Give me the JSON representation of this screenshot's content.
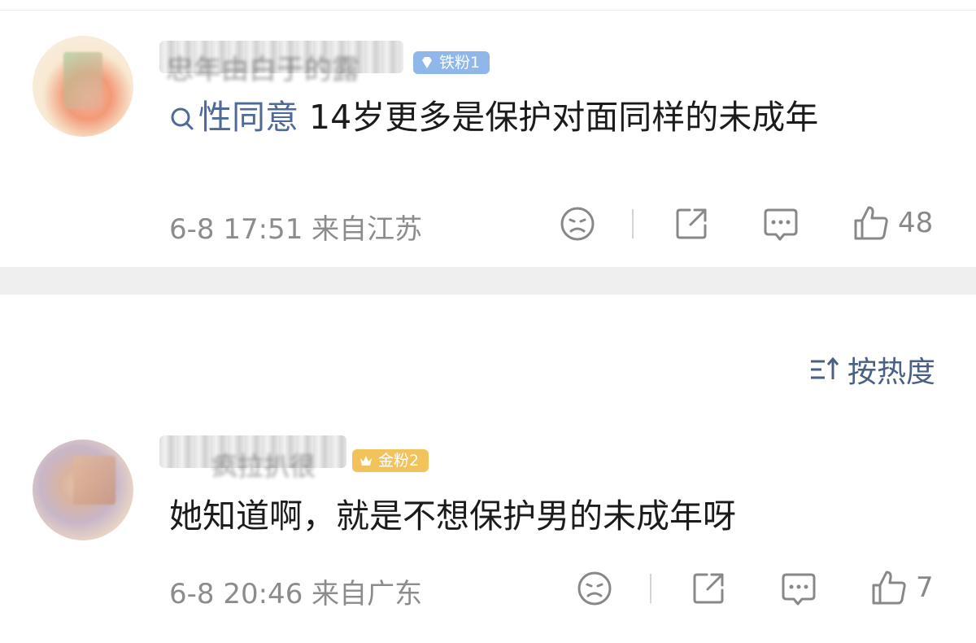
{
  "comments": [
    {
      "username_fragment": "忠年由白于的露",
      "badge": "铁粉1",
      "search_keyword": "性同意",
      "text": " 14岁更多是保护对面同样的未成年",
      "time_location": "6-8 17:51 来自江苏",
      "likes": "48"
    },
    {
      "username_fragment": "疯拉扒很",
      "badge": "金粉2",
      "text": "她知道啊，就是不想保护男的未成年呀",
      "time_location": "6-8 20:46 来自广东",
      "likes": "7"
    }
  ],
  "sort": {
    "label": "按热度"
  },
  "colors": {
    "link": "#4e6a96",
    "meta": "#8c8c8c",
    "badge_iron": "#8fb7ea",
    "badge_gold": "#f2c35a",
    "separator": "#efefef"
  },
  "icons": [
    "search-icon",
    "dislike-face-icon",
    "share-icon",
    "comment-icon",
    "thumb-up-icon",
    "sort-icon",
    "diamond-icon",
    "crown-icon"
  ]
}
